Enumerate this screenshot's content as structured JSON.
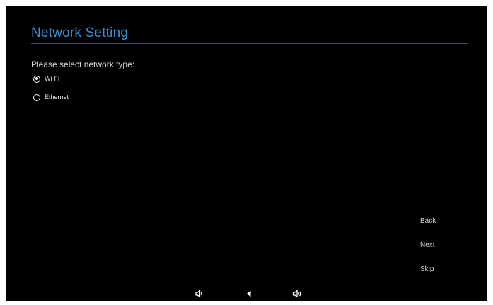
{
  "header": {
    "title": "Network Setting"
  },
  "network": {
    "prompt": "Please select network type:",
    "options": [
      {
        "label": "Wi-Fi",
        "selected": true
      },
      {
        "label": "Ethernet",
        "selected": false
      }
    ]
  },
  "actions": {
    "back": "Back",
    "next": "Next",
    "skip": "Skip"
  },
  "navbar": {
    "icons": [
      "volume-down-icon",
      "nav-back-icon",
      "volume-up-icon"
    ]
  },
  "colors": {
    "background": "#000000",
    "title": "#3a8fd9",
    "text": "#d8d8d8"
  }
}
